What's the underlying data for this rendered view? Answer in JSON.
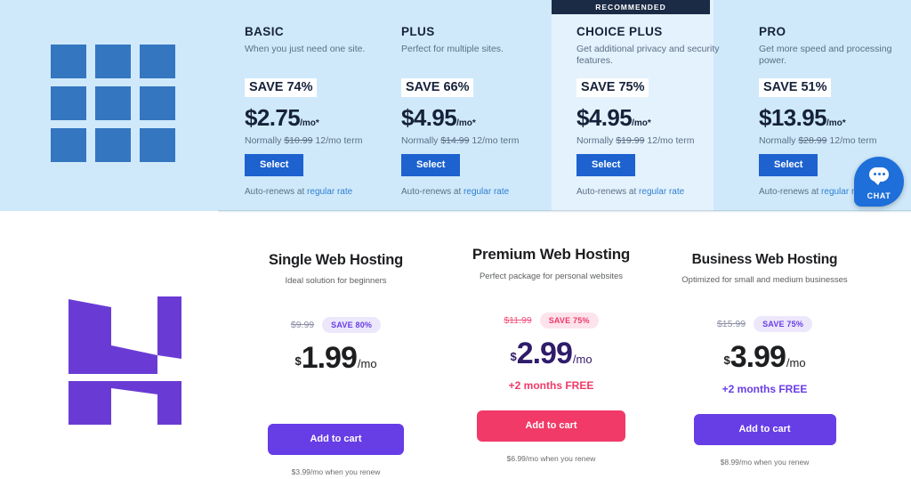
{
  "bluehost": {
    "logo_icon": "bluehost-grid-logo",
    "ribbon_label": "RECOMMENDED",
    "plans": [
      {
        "name": "BASIC",
        "description": "When you just need one site.",
        "save": "SAVE 74%",
        "price": "$2.75",
        "price_suffix": "/mo*",
        "normally_prefix": "Normally",
        "normally_price": "$10.99",
        "normally_suffix": "12/mo term",
        "select_label": "Select",
        "renew_text": "Auto-renews at ",
        "renew_link": "regular rate",
        "recommended": false
      },
      {
        "name": "PLUS",
        "description": "Perfect for multiple sites.",
        "save": "SAVE 66%",
        "price": "$4.95",
        "price_suffix": "/mo*",
        "normally_prefix": "Normally",
        "normally_price": "$14.99",
        "normally_suffix": "12/mo term",
        "select_label": "Select",
        "renew_text": "Auto-renews at ",
        "renew_link": "regular rate",
        "recommended": false
      },
      {
        "name": "CHOICE PLUS",
        "description": "Get additional privacy and security features.",
        "save": "SAVE 75%",
        "price": "$4.95",
        "price_suffix": "/mo*",
        "normally_prefix": "Normally",
        "normally_price": "$19.99",
        "normally_suffix": "12/mo term",
        "select_label": "Select",
        "renew_text": "Auto-renews at ",
        "renew_link": "regular rate",
        "recommended": true
      },
      {
        "name": "PRO",
        "description": "Get more speed and processing power.",
        "save": "SAVE 51%",
        "price": "$13.95",
        "price_suffix": "/mo*",
        "normally_prefix": "Normally",
        "normally_price": "$28.99",
        "normally_suffix": "12/mo term",
        "select_label": "Select",
        "renew_text": "Auto-renews at ",
        "renew_link": "regular rate",
        "recommended": false
      }
    ],
    "chat": {
      "label": "CHAT",
      "icon": "chat-bubble-icon",
      "color": "#1e6fd9"
    },
    "colors": {
      "background": "#cfe9fb",
      "highlight_column": "#e4f2fd",
      "button": "#1d62cf",
      "ribbon": "#1b2a45",
      "logo": "#3476c0"
    }
  },
  "hostinger": {
    "logo_icon": "hostinger-h-logo",
    "cards": [
      {
        "title": "Single Web Hosting",
        "subtitle": "Ideal solution for beginners",
        "old_price": "$9.99",
        "badge": "SAVE 80%",
        "currency": "$",
        "amount": "1.99",
        "per": "/mo",
        "free_months": "",
        "cart_label": "Add to cart",
        "renew": "$3.99/mo when you renew",
        "accent": "#673de6"
      },
      {
        "title": "Premium Web Hosting",
        "subtitle": "Perfect package for personal websites",
        "old_price": "$11.99",
        "badge": "SAVE 75%",
        "currency": "$",
        "amount": "2.99",
        "per": "/mo",
        "free_months": "+2 months FREE",
        "cart_label": "Add to cart",
        "renew": "$6.99/mo when you renew",
        "accent": "#f13a68"
      },
      {
        "title": "Business Web Hosting",
        "subtitle": "Optimized for small and medium businesses",
        "old_price": "$15.99",
        "badge": "SAVE 75%",
        "currency": "$",
        "amount": "3.99",
        "per": "/mo",
        "free_months": "+2 months FREE",
        "cart_label": "Add to cart",
        "renew": "$8.99/mo when you renew",
        "accent": "#673de6"
      }
    ],
    "colors": {
      "background": "#ffffff",
      "logo": "#6a3bd4",
      "purple": "#673de6",
      "pink": "#f13a68"
    }
  }
}
